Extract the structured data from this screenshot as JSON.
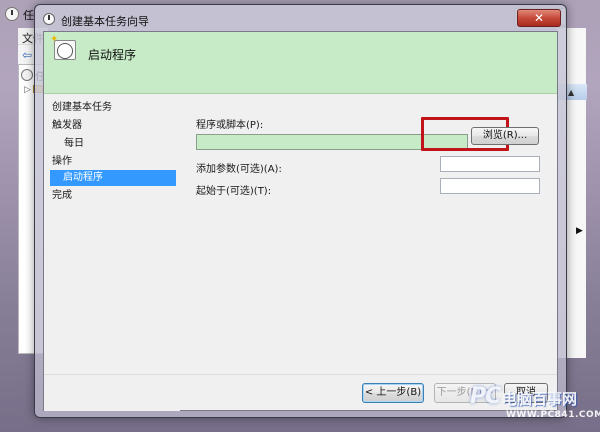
{
  "background_window": {
    "title": "任",
    "menu_first": "文件",
    "tree_root_label": "任",
    "back_arrow": "⇦",
    "expander": "▷",
    "right_caret": "▲",
    "right_arrow": "▶"
  },
  "dialog": {
    "title": "创建基本任务向导",
    "close_label": "✕",
    "header_title": "启动程序"
  },
  "nav": {
    "items": [
      {
        "label": "创建基本任务",
        "indent": 0,
        "selected": false
      },
      {
        "label": "触发器",
        "indent": 0,
        "selected": false
      },
      {
        "label": "每日",
        "indent": 1,
        "selected": false
      },
      {
        "label": "操作",
        "indent": 0,
        "selected": false
      },
      {
        "label": "启动程序",
        "indent": 1,
        "selected": true
      },
      {
        "label": "完成",
        "indent": 0,
        "selected": false
      }
    ]
  },
  "form": {
    "program_label": "程序或脚本(P):",
    "program_value": "",
    "browse_label": "浏览(R)...",
    "args_label": "添加参数(可选)(A):",
    "args_value": "",
    "startin_label": "起始于(可选)(T):",
    "startin_value": ""
  },
  "footer": {
    "back_label": "< 上一步(B)",
    "next_label": "下一步(N) >",
    "cancel_label": "取消"
  },
  "watermark": {
    "logo": "PC",
    "text": "电脑百事网",
    "url": "WWW.PC841.COM"
  },
  "colors": {
    "header_band": "#c6ebc6",
    "selection": "#3399ff",
    "highlight_box": "#c0131a",
    "close_button": "#c74a3a"
  }
}
